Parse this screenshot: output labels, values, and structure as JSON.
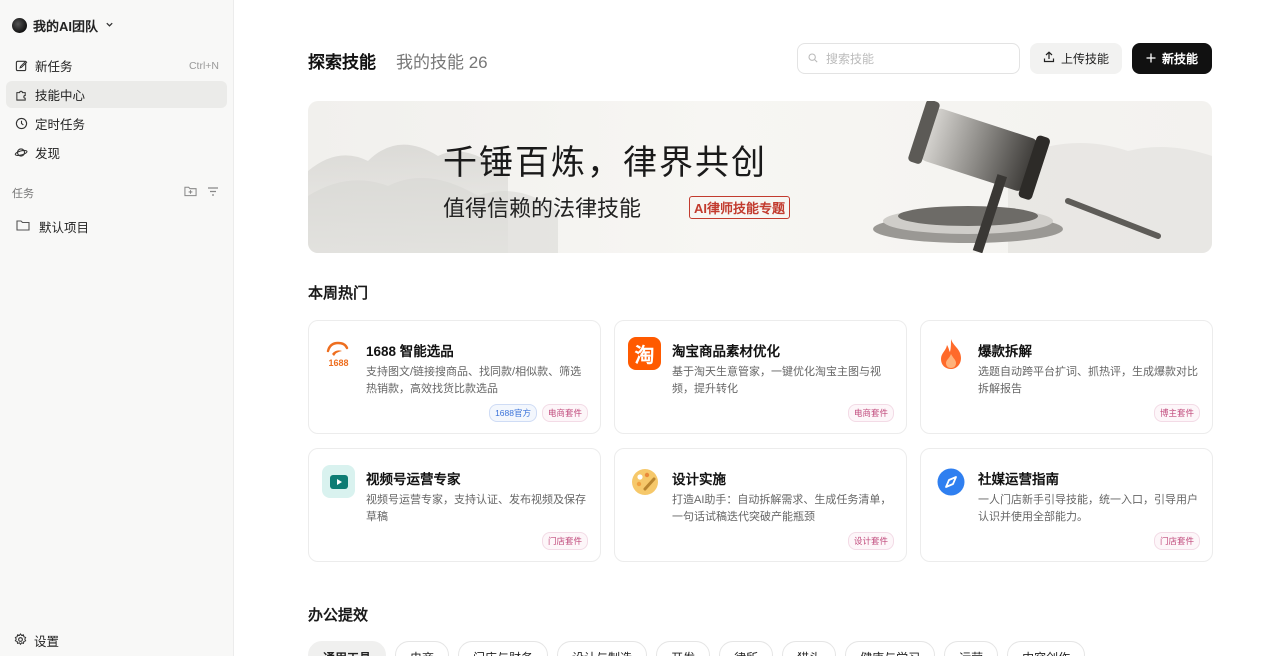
{
  "sidebar": {
    "team_name": "我的AI团队",
    "nav": [
      {
        "label": "新任务",
        "shortcut": "Ctrl+N"
      },
      {
        "label": "技能中心"
      },
      {
        "label": "定时任务"
      },
      {
        "label": "发现"
      }
    ],
    "section_label": "任务",
    "project": "默认项目",
    "settings": "设置"
  },
  "header": {
    "tabs": [
      {
        "label": "探索技能"
      },
      {
        "label": "我的技能 26"
      }
    ],
    "search_placeholder": "搜索技能",
    "upload_label": "上传技能",
    "new_label": "新技能"
  },
  "banner": {
    "title": "千锤百炼，律界共创",
    "subtitle": "值得信赖的法律技能",
    "tag": "AI律师技能专题"
  },
  "hot": {
    "heading": "本周热门",
    "cards": [
      {
        "name": "1688 智能选品",
        "logo_text": "1688",
        "desc": "支持图文/链接搜商品、找同款/相似款、筛选热销款，高效找货比款选品",
        "tags": [
          "1688官方",
          "电商套件"
        ]
      },
      {
        "name": "淘宝商品素材优化",
        "logo_text": "淘",
        "desc": "基于淘天生意管家，一键优化淘宝主图与视频，提升转化",
        "tags": [
          "电商套件"
        ]
      },
      {
        "name": "爆款拆解",
        "desc": "选题自动跨平台扩词、抓热评，生成爆款对比拆解报告",
        "tags": [
          "博主套件"
        ]
      },
      {
        "name": "视频号运营专家",
        "desc": "视频号运营专家，支持认证、发布视频及保存草稿",
        "tags": [
          "门店套件"
        ]
      },
      {
        "name": "设计实施",
        "desc": "打造AI助手：自动拆解需求、生成任务清单，一句话试稿迭代突破产能瓶颈",
        "tags": [
          "设计套件"
        ]
      },
      {
        "name": "社媒运营指南",
        "desc": "一人门店新手引导技能，统一入口，引导用户认识并使用全部能力。",
        "tags": [
          "门店套件"
        ]
      }
    ]
  },
  "office": {
    "heading": "办公提效",
    "chips": [
      "通用工具",
      "电商",
      "门店与财务",
      "设计与制造",
      "开发",
      "律所",
      "猎头",
      "健康与学习",
      "运营",
      "内容创作"
    ]
  }
}
